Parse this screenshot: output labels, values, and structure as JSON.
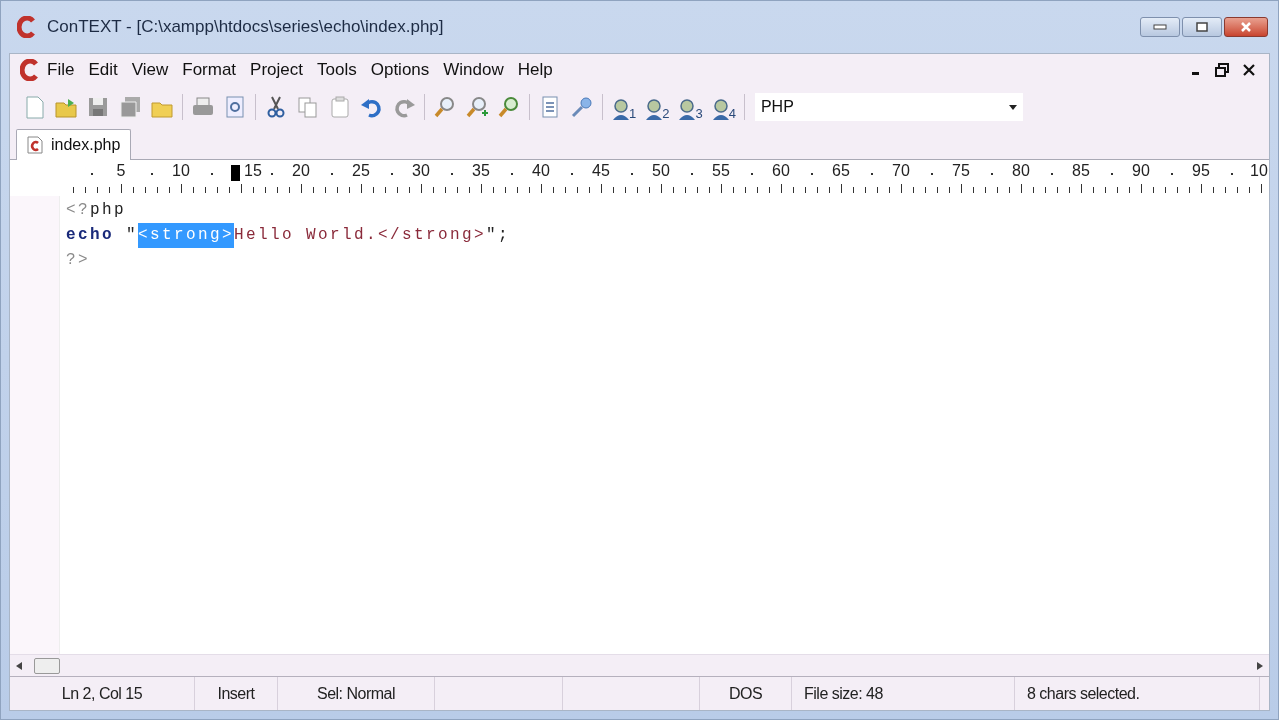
{
  "window": {
    "title": "ConTEXT - [C:\\xampp\\htdocs\\series\\echo\\index.php]"
  },
  "menu": [
    "File",
    "Edit",
    "View",
    "Format",
    "Project",
    "Tools",
    "Options",
    "Window",
    "Help"
  ],
  "toolbar": [
    {
      "kind": "new"
    },
    {
      "kind": "open"
    },
    {
      "kind": "save"
    },
    {
      "kind": "saveall"
    },
    {
      "kind": "folder"
    },
    {
      "kind": "sep"
    },
    {
      "kind": "print"
    },
    {
      "kind": "preview"
    },
    {
      "kind": "sep"
    },
    {
      "kind": "cut"
    },
    {
      "kind": "copy"
    },
    {
      "kind": "paste"
    },
    {
      "kind": "undo"
    },
    {
      "kind": "redo"
    },
    {
      "kind": "sep"
    },
    {
      "kind": "find"
    },
    {
      "kind": "findnext"
    },
    {
      "kind": "replace"
    },
    {
      "kind": "sep"
    },
    {
      "kind": "doc"
    },
    {
      "kind": "pin"
    },
    {
      "kind": "sep"
    },
    {
      "kind": "user",
      "label": "1"
    },
    {
      "kind": "user",
      "label": "2"
    },
    {
      "kind": "user",
      "label": "3"
    },
    {
      "kind": "user",
      "label": "4"
    },
    {
      "kind": "sep"
    }
  ],
  "highlighter": {
    "value": "PHP"
  },
  "tabs": [
    {
      "label": "index.php",
      "selected": true
    }
  ],
  "ruler": {
    "labels": [
      "5",
      "10",
      "15",
      "20",
      "25",
      "30",
      "35",
      "40",
      "45",
      "50",
      "55",
      "60",
      "65",
      "70",
      "75",
      "80",
      "85",
      "90",
      "95",
      "10"
    ]
  },
  "code": [
    [
      {
        "kind": "delimiter",
        "text": "<?",
        "selected": false
      },
      {
        "kind": "plain",
        "text": "php",
        "selected": false
      }
    ],
    [
      {
        "kind": "keyword",
        "text": "echo",
        "selected": false
      },
      {
        "kind": "plain",
        "text": " \"",
        "selected": false
      },
      {
        "kind": "string",
        "text": "<strong>",
        "selected": true
      },
      {
        "kind": "string",
        "text": "Hello World.</strong>",
        "selected": false
      },
      {
        "kind": "plain",
        "text": "\";",
        "selected": false
      }
    ],
    [
      {
        "kind": "delimiter",
        "text": "?>",
        "selected": false
      }
    ]
  ],
  "status_bar": [
    "Ln 2, Col 15",
    "Insert",
    "Sel: Normal",
    "DOS",
    "File size: 48",
    "8 chars selected."
  ]
}
